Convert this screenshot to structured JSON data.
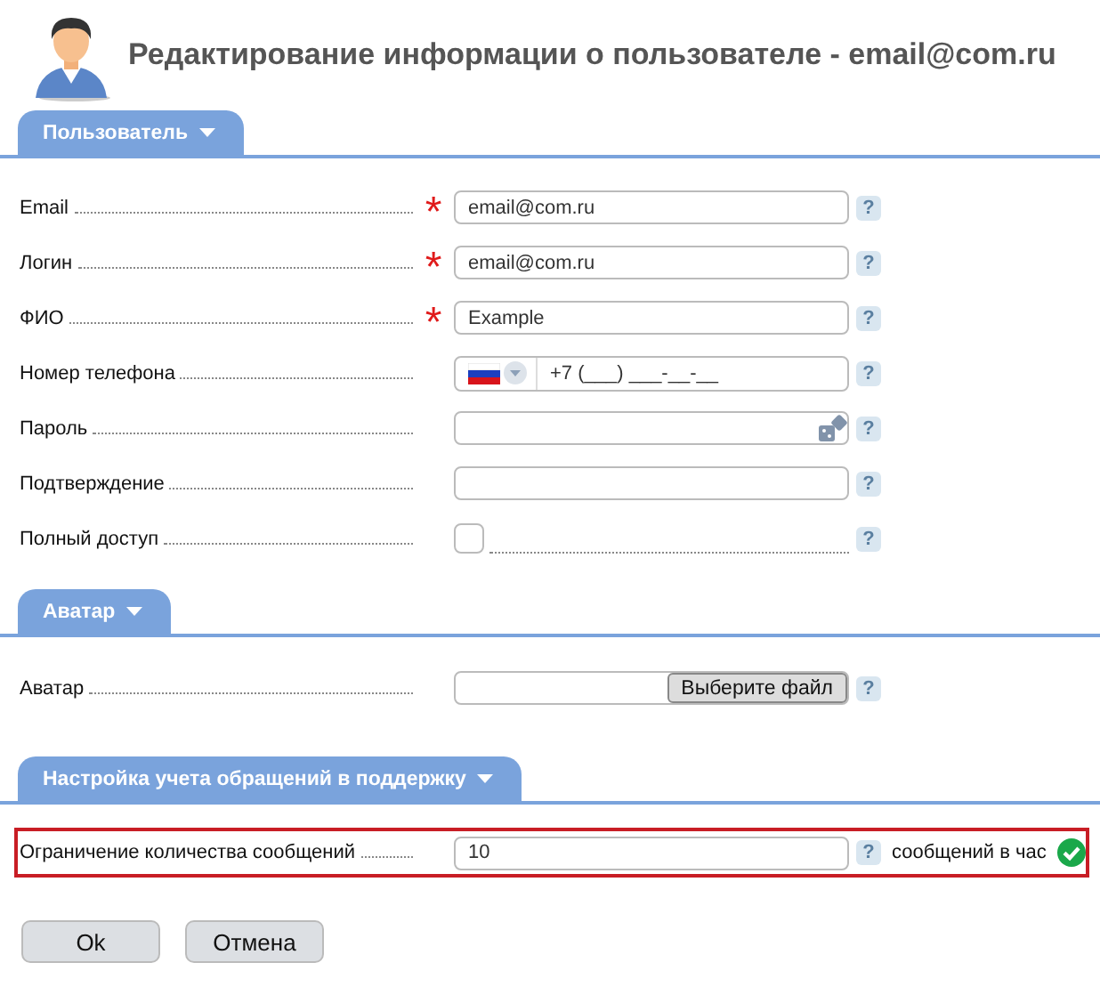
{
  "title": "Редактирование информации о пользователе - email@com.ru",
  "sections": [
    {
      "tab": "Пользователь",
      "fields": [
        {
          "kind": "text",
          "label": "Email",
          "required_mark": "*",
          "value": "email@com.ru",
          "help": "?"
        },
        {
          "kind": "text",
          "label": "Логин",
          "required_mark": "*",
          "value": "email@com.ru",
          "help": "?"
        },
        {
          "kind": "text",
          "label": "ФИО",
          "required_mark": "*",
          "value": "Example",
          "help": "?"
        },
        {
          "kind": "phone",
          "label": "Номер телефона",
          "value": "+7 (___) ___-__-__",
          "help": "?"
        },
        {
          "kind": "password",
          "label": "Пароль",
          "help": "?"
        },
        {
          "kind": "password_confirm",
          "label": "Подтверждение",
          "help": "?"
        },
        {
          "kind": "checkbox",
          "label": "Полный доступ",
          "checked": false,
          "help": "?"
        }
      ]
    },
    {
      "tab": "Аватар",
      "fields": [
        {
          "kind": "file",
          "label": "Аватар",
          "button": "Выберите файл",
          "help": "?"
        }
      ]
    },
    {
      "tab": "Настройка учета обращений в поддержку",
      "fields": [
        {
          "kind": "text",
          "label": "Ограничение количества сообщений",
          "value": "10",
          "help": "?",
          "highlighted": true,
          "suffix": "сообщений в час",
          "valid": true
        }
      ]
    }
  ],
  "buttons": [
    "Ok",
    "Отмена"
  ]
}
